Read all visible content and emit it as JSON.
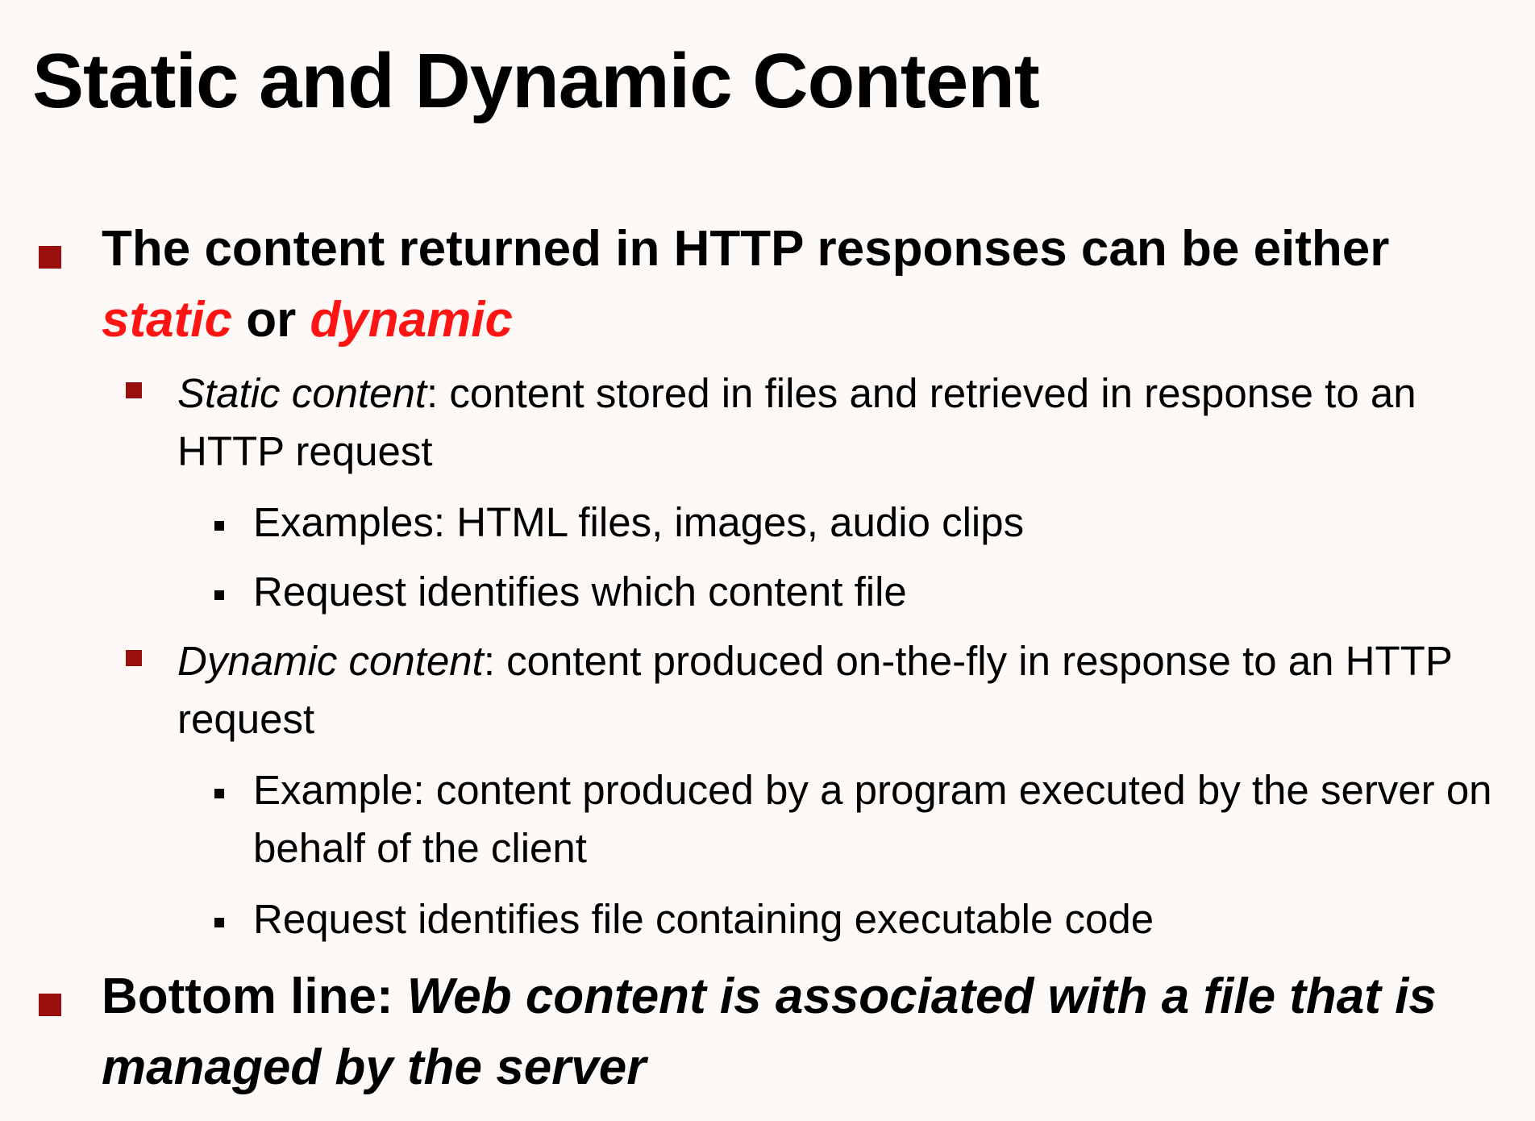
{
  "slide": {
    "title": "Static and Dynamic Content",
    "bullet1": {
      "lead": "The content returned in HTTP responses can be either",
      "static_word": "static",
      "or_word": "or",
      "dynamic_word": "dynamic"
    },
    "static_content": {
      "term": "Static content",
      "definition": ": content stored in files and retrieved in response to an HTTP request",
      "examples": [
        "Examples: HTML files, images, audio clips",
        "Request identifies which content file"
      ]
    },
    "dynamic_content": {
      "term": "Dynamic content",
      "definition": ": content produced on-the-fly in response to an HTTP request",
      "examples": [
        "Example: content produced by a program executed by the server on behalf of the client",
        "Request identifies file containing executable code"
      ]
    },
    "bottom_line": {
      "label": "Bottom line: ",
      "statement": "Web content is associated with a file that is managed by the server"
    }
  },
  "colors": {
    "background": "#fdf9f7",
    "bullet_red": "#9b0e0e",
    "highlight_red": "#ff1414"
  }
}
